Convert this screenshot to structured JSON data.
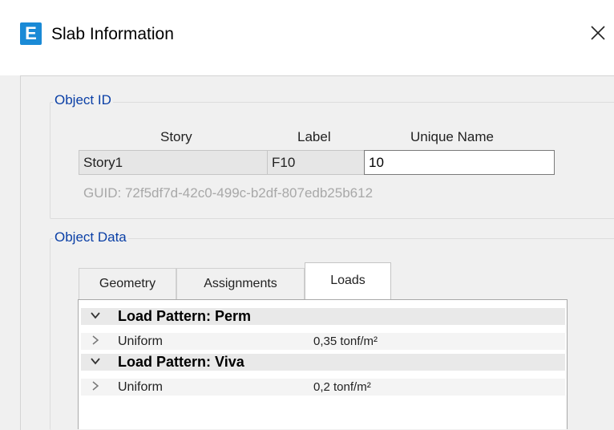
{
  "window": {
    "app_icon_letter": "E",
    "title": "Slab Information"
  },
  "object_id": {
    "legend": "Object ID",
    "headers": {
      "story": "Story",
      "label": "Label",
      "unique_name": "Unique Name"
    },
    "story_value": "Story1",
    "label_value": "F10",
    "unique_name_value": "10",
    "guid_text": "GUID:  72f5df7d-42c0-499c-b2df-807edb25b612"
  },
  "object_data": {
    "legend": "Object Data",
    "tabs": [
      {
        "label": "Geometry",
        "active": false
      },
      {
        "label": "Assignments",
        "active": false
      },
      {
        "label": "Loads",
        "active": true
      }
    ],
    "load_patterns": [
      {
        "title": "Load Pattern: Perm",
        "expanded": true,
        "items": [
          {
            "label": "Uniform",
            "value": "0,35 tonf/m²",
            "expanded": false
          }
        ]
      },
      {
        "title": "Load Pattern: Viva",
        "expanded": true,
        "items": [
          {
            "label": "Uniform",
            "value": "0,2 tonf/m²",
            "expanded": false
          }
        ]
      }
    ]
  },
  "colors": {
    "accent_icon": "#1a8ad6",
    "legend_text": "#0a3fa6",
    "guid_text": "#a8a8a8"
  }
}
